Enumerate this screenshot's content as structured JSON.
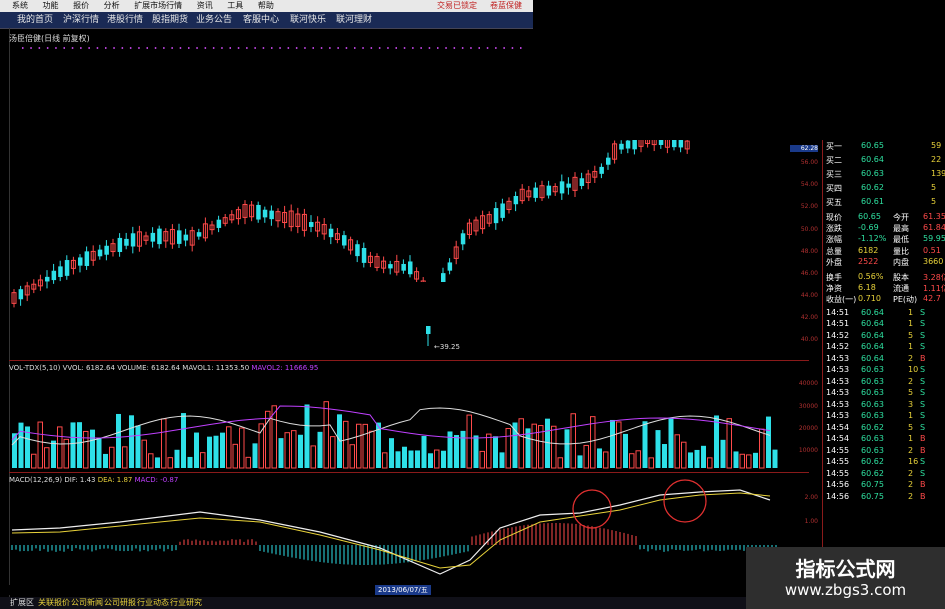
{
  "menubar": {
    "items": [
      "系统",
      "功能",
      "报价",
      "分析",
      "扩展市场行情",
      "资讯",
      "工具",
      "帮助"
    ],
    "right_labels": [
      "交易已锁定",
      "卷蓝保健"
    ]
  },
  "navbar": {
    "tabs": [
      "我的首页",
      "沪深行情",
      "港股行情",
      "股指期货",
      "业务公告",
      "客服中心",
      "联河快乐",
      "联河理财"
    ]
  },
  "stock_line": "汤臣倍健(日线 前复权)",
  "price_chart": {
    "axis_labels": [
      "62.28",
      "56.00",
      "54.00",
      "52.00",
      "50.00",
      "48.00",
      "46.00",
      "44.00",
      "42.00",
      "40.00"
    ],
    "low_marker": "39.25"
  },
  "volume_panel": {
    "parts": [
      "VOL-TDX(5,10) VVOL: 6182.64",
      "VOLUME: 6182.64",
      "MAVOL1: 11353.50",
      "MAVOL2: 11666.95"
    ],
    "axis_labels": [
      "40000",
      "30000",
      "20000",
      "10000"
    ]
  },
  "macd_panel": {
    "parts": [
      "MACD(12,26,9) DIF: 1.43",
      "DEA: 1.87",
      "MACD: -0.87"
    ],
    "axis_labels": [
      "2.00",
      "1.00"
    ]
  },
  "date_strip": {
    "selected": "2013/06/07/五"
  },
  "quote_panel": {
    "orders": [
      {
        "label": "买一",
        "price": "60.65",
        "vol": "59"
      },
      {
        "label": "买二",
        "price": "60.64",
        "vol": "22"
      },
      {
        "label": "买三",
        "price": "60.63",
        "vol": "139"
      },
      {
        "label": "买四",
        "price": "60.62",
        "vol": "5"
      },
      {
        "label": "买五",
        "price": "60.61",
        "vol": "5"
      }
    ],
    "stats": [
      {
        "l1": "现价",
        "v1": "60.65",
        "l2": "今开",
        "v2": "61.35"
      },
      {
        "l1": "涨跌",
        "v1": "-0.69",
        "l2": "最高",
        "v2": "61.84"
      },
      {
        "l1": "涨幅",
        "v1": "-1.12%",
        "l2": "最低",
        "v2": "59.95"
      },
      {
        "l1": "总量",
        "v1": "6182",
        "l2": "量比",
        "v2": "0.51"
      },
      {
        "l1": "外盘",
        "v1": "2522",
        "l2": "内盘",
        "v2": "3660"
      },
      {
        "l1": "换手",
        "v1": "0.56%",
        "l2": "股本",
        "v2": "3.28亿"
      },
      {
        "l1": "净资",
        "v1": "6.18",
        "l2": "流通",
        "v2": "1.11亿"
      },
      {
        "l1": "收益(一)",
        "v1": "0.710",
        "l2": "PE(动)",
        "v2": "42.7"
      }
    ],
    "ticks": [
      {
        "t": "14:51",
        "p": "60.64",
        "v": "1",
        "s": "S"
      },
      {
        "t": "14:51",
        "p": "60.64",
        "v": "1",
        "s": "S"
      },
      {
        "t": "14:52",
        "p": "60.64",
        "v": "5",
        "s": "S"
      },
      {
        "t": "14:52",
        "p": "60.64",
        "v": "1",
        "s": "S"
      },
      {
        "t": "14:53",
        "p": "60.64",
        "v": "2",
        "s": "B"
      },
      {
        "t": "14:53",
        "p": "60.63",
        "v": "10",
        "s": "S"
      },
      {
        "t": "14:53",
        "p": "60.63",
        "v": "2",
        "s": "S"
      },
      {
        "t": "14:53",
        "p": "60.63",
        "v": "5",
        "s": "S"
      },
      {
        "t": "14:53",
        "p": "60.63",
        "v": "3",
        "s": "S"
      },
      {
        "t": "14:53",
        "p": "60.63",
        "v": "1",
        "s": "S"
      },
      {
        "t": "14:54",
        "p": "60.62",
        "v": "5",
        "s": "S"
      },
      {
        "t": "14:54",
        "p": "60.63",
        "v": "1",
        "s": "B"
      },
      {
        "t": "14:55",
        "p": "60.63",
        "v": "2",
        "s": "B"
      },
      {
        "t": "14:55",
        "p": "60.62",
        "v": "16",
        "s": "S"
      },
      {
        "t": "14:55",
        "p": "60.62",
        "v": "2",
        "s": "S"
      },
      {
        "t": "14:56",
        "p": "60.75",
        "v": "2",
        "s": "B"
      },
      {
        "t": "14:56",
        "p": "60.75",
        "v": "2",
        "s": "B"
      }
    ]
  },
  "bottom_tabs": [
    "扩展区",
    "关联报价",
    "公司新闻",
    "公司研报",
    "行业动态",
    "行业研究"
  ],
  "watermark": {
    "title": "指标公式网",
    "url": "www.zbgs3.com"
  },
  "colors": {
    "up": "#ff4a4a",
    "down": "#2ee0e8",
    "bg": "#000000",
    "nav_bg": "#1a2a55",
    "grid": "#8a1a1a"
  }
}
